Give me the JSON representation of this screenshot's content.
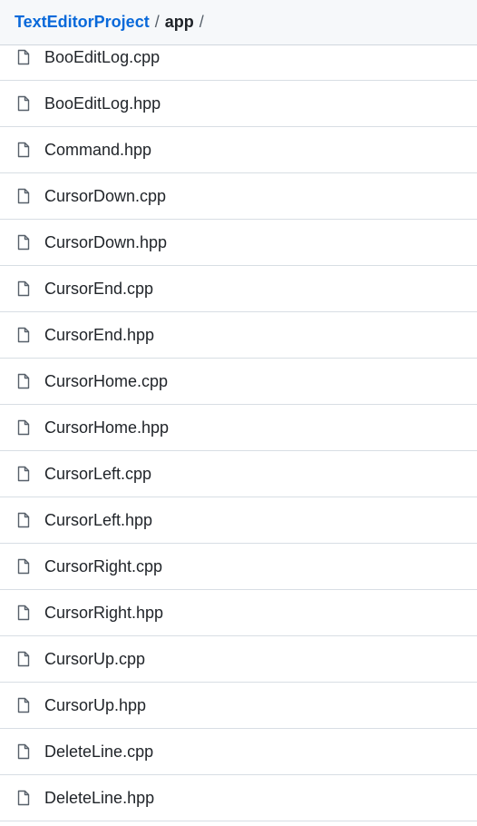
{
  "breadcrumb": {
    "repo": "TextEditorProject",
    "separator": "/",
    "folder": "app",
    "trailing": "/"
  },
  "icons": {
    "file": "file-icon"
  },
  "colors": {
    "link": "#0969da",
    "text": "#1f2328",
    "header_bg": "#f6f8fa",
    "divider": "#d8dee4"
  },
  "files": [
    {
      "name": "BooEditLog.cpp"
    },
    {
      "name": "BooEditLog.hpp"
    },
    {
      "name": "Command.hpp"
    },
    {
      "name": "CursorDown.cpp"
    },
    {
      "name": "CursorDown.hpp"
    },
    {
      "name": "CursorEnd.cpp"
    },
    {
      "name": "CursorEnd.hpp"
    },
    {
      "name": "CursorHome.cpp"
    },
    {
      "name": "CursorHome.hpp"
    },
    {
      "name": "CursorLeft.cpp"
    },
    {
      "name": "CursorLeft.hpp"
    },
    {
      "name": "CursorRight.cpp"
    },
    {
      "name": "CursorRight.hpp"
    },
    {
      "name": "CursorUp.cpp"
    },
    {
      "name": "CursorUp.hpp"
    },
    {
      "name": "DeleteLine.cpp"
    },
    {
      "name": "DeleteLine.hpp"
    }
  ]
}
